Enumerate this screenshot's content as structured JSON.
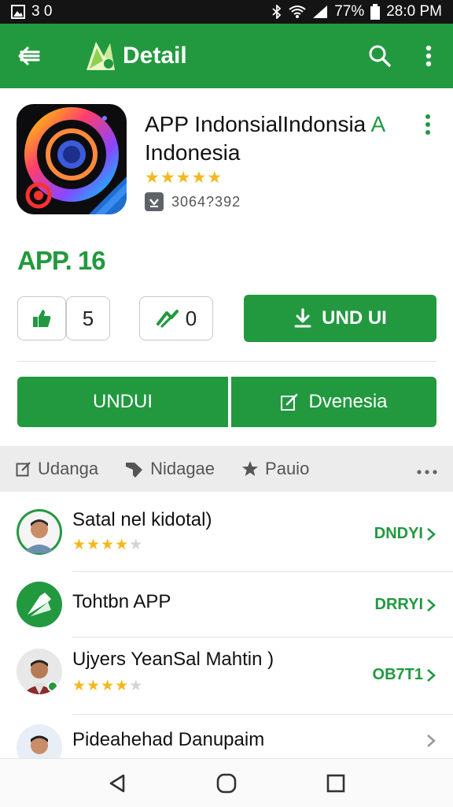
{
  "status_bar": {
    "left_text": "3 0",
    "battery": "77%",
    "time": "28:0 PM"
  },
  "app_bar": {
    "title": "Detail"
  },
  "app": {
    "name_line1": "APP IndonsialIndonsia",
    "name_accent": "A",
    "name_line2": "Indonesia",
    "rating": 4.5,
    "downloads": "3064?392",
    "price": "APP. 16"
  },
  "actions": {
    "like_count": "5",
    "share_count": "0",
    "install_label": "UND UI"
  },
  "buttons": {
    "left_label": "UNDUI",
    "right_label": "Dvenesia"
  },
  "tabs": [
    {
      "label": "Udanga",
      "icon": "edit-square-icon"
    },
    {
      "label": "Nidagae",
      "icon": "tag-icon"
    },
    {
      "label": "Pauio",
      "icon": "star-icon"
    }
  ],
  "list": [
    {
      "title": "Satal nel kidotal)",
      "rating": 4,
      "action": "DNDYI",
      "avatar": "person-avatar"
    },
    {
      "title": "Tohtbn APP",
      "rating": 0,
      "action": "DRRYI",
      "avatar": "app-logo-avatar"
    },
    {
      "title": "Ujyers YeanSal Mahtin )",
      "rating": 4,
      "action": "OB7T1",
      "avatar": "person-avatar"
    },
    {
      "title": "Pideahehad Danupaim",
      "rating": 0,
      "action": "",
      "avatar": "person-avatar"
    }
  ],
  "colors": {
    "brand": "#22993f",
    "star": "#f3b81b"
  }
}
